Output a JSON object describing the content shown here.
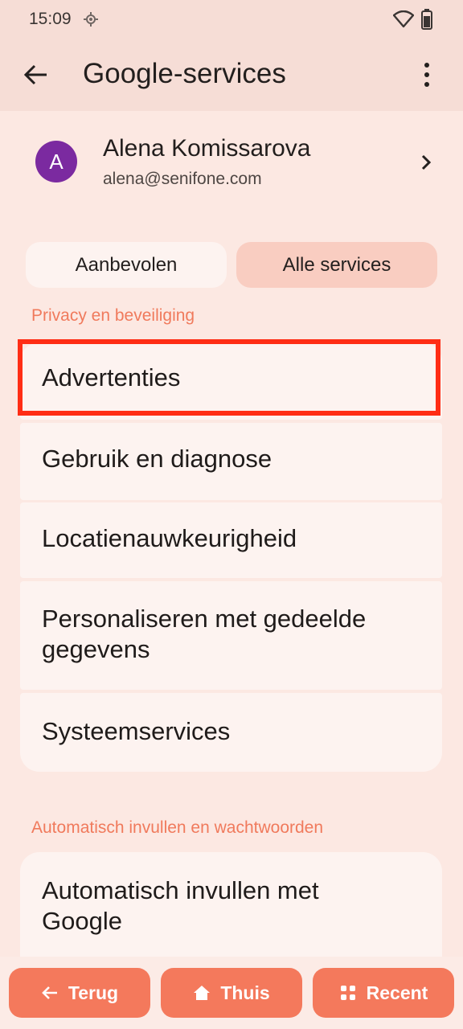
{
  "status": {
    "time": "15:09"
  },
  "appbar": {
    "title": "Google-services"
  },
  "account": {
    "initial": "A",
    "name": "Alena Komissarova",
    "email": "alena@senifone.com"
  },
  "tabs": {
    "recommended": "Aanbevolen",
    "all": "Alle services"
  },
  "sections": {
    "privacy": {
      "header": "Privacy en beveiliging",
      "items": [
        "Advertenties",
        "Gebruik en diagnose",
        "Locatienauwkeurigheid",
        "Personaliseren met gedeelde gegevens",
        "Systeemservices"
      ]
    },
    "autofill": {
      "header": "Automatisch invullen en wachtwoorden",
      "items": [
        "Automatisch invullen met Google"
      ]
    }
  },
  "navbar": {
    "back": "Terug",
    "home": "Thuis",
    "recent": "Recent"
  },
  "colors": {
    "accent": "#f4795c",
    "section_header": "#f07a5c",
    "highlight": "#ff2d15",
    "avatar": "#7b2aa0"
  }
}
